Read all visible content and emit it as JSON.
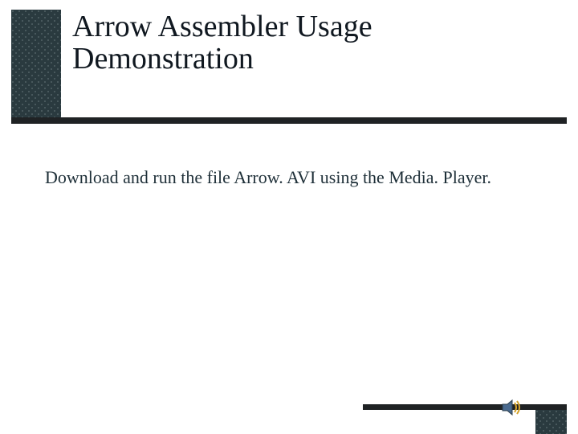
{
  "slide": {
    "title_line1": "Arrow Assembler Usage",
    "title_line2": "Demonstration",
    "body": "Download and run the file Arrow. AVI using the Media. Player."
  },
  "icons": {
    "sound": "speaker-icon"
  },
  "colors": {
    "rule": "#1f2224",
    "pattern_bg": "#2a3a3f"
  }
}
